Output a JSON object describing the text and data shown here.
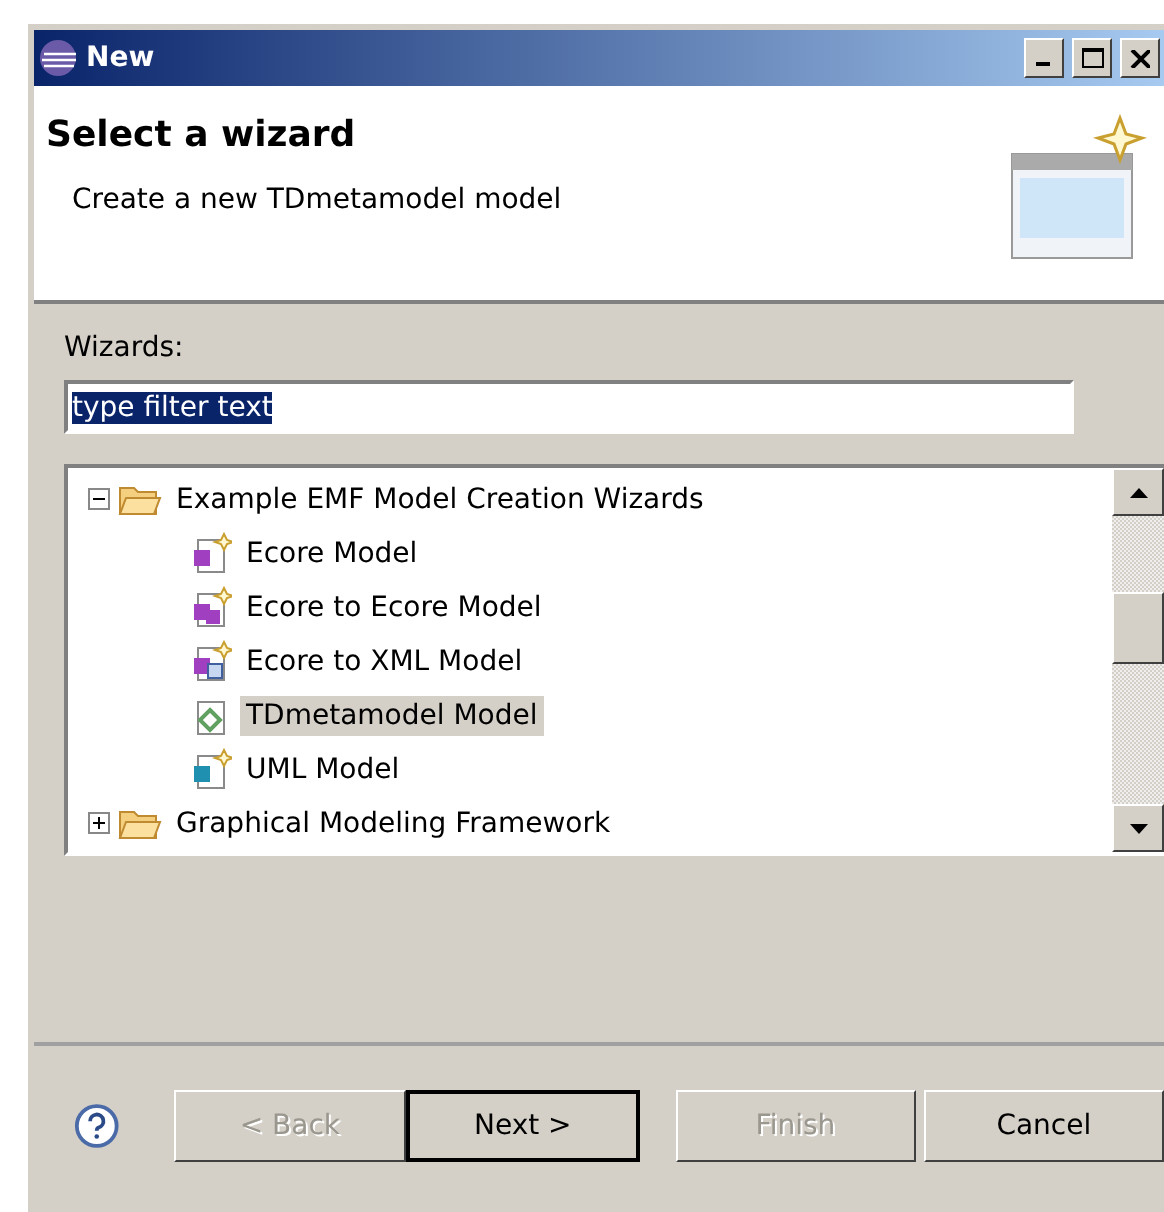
{
  "window": {
    "title": "New"
  },
  "header": {
    "title": "Select a wizard",
    "description": "Create a new TDmetamodel model"
  },
  "filter": {
    "label": "Wizards:",
    "value": "type filter text",
    "value_selected": true
  },
  "tree": [
    {
      "label": "Example EMF Model Creation Wizards",
      "kind": "folder",
      "expanded": true,
      "selected": false,
      "children": [
        {
          "label": "Ecore Model",
          "kind": "ecore",
          "selected": false
        },
        {
          "label": "Ecore to Ecore Model",
          "kind": "ecore-ecore",
          "selected": false
        },
        {
          "label": "Ecore to XML Model",
          "kind": "ecore-xml",
          "selected": false
        },
        {
          "label": "TDmetamodel Model",
          "kind": "tdmeta",
          "selected": true
        },
        {
          "label": "UML Model",
          "kind": "uml",
          "selected": false
        }
      ]
    },
    {
      "label": "Graphical Modeling Framework",
      "kind": "folder",
      "expanded": false,
      "selected": false
    }
  ],
  "buttons": [
    {
      "label": "< Back",
      "disabled": true,
      "default": false
    },
    {
      "label": "Next >",
      "disabled": false,
      "default": true
    },
    {
      "label": "Finish",
      "disabled": true,
      "default": false
    },
    {
      "label": "Cancel",
      "disabled": false,
      "default": false
    }
  ]
}
